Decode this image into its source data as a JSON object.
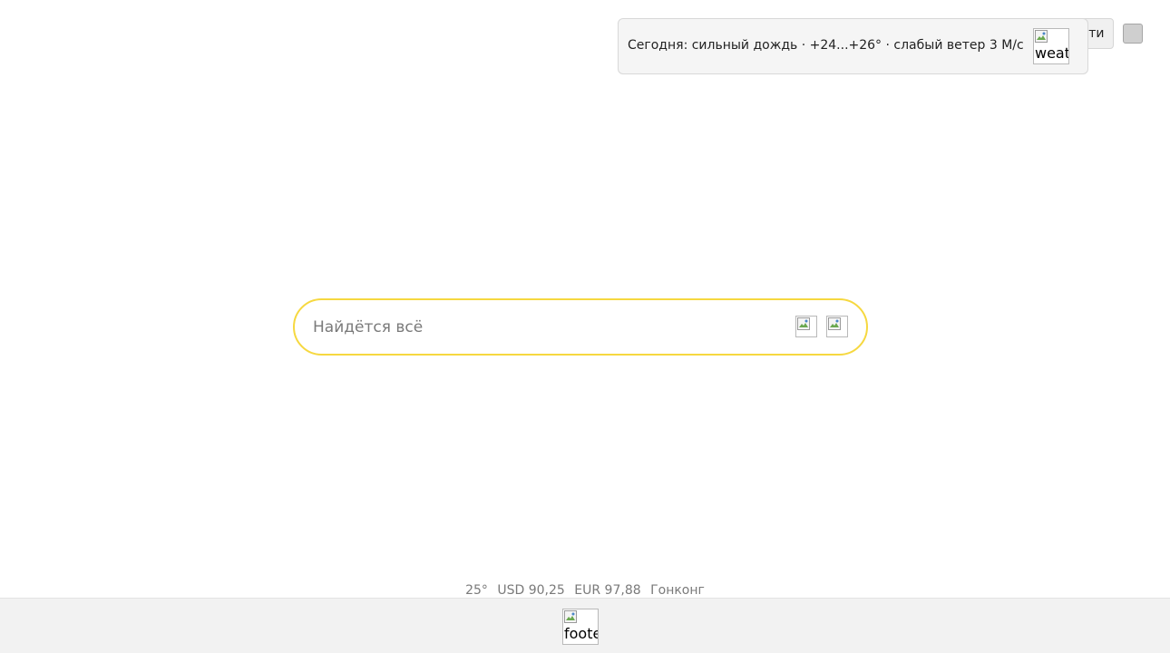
{
  "header": {
    "login_label": "Войти"
  },
  "weather_popup": {
    "text": "Сегодня: сильный дождь · +24...+26° · слабый ветер 3 М/с",
    "image_alt": "weat"
  },
  "search": {
    "placeholder": "Найдётся всё",
    "value": ""
  },
  "info_line": {
    "temperature": "25°",
    "usd": "USD 90,25",
    "eur": "EUR 97,88",
    "city": "Гонконг"
  },
  "footer": {
    "image_alt": "foote"
  },
  "colors": {
    "search_border": "#f6d840",
    "footer_bg": "#f2f2f2",
    "muted_text": "#7a7a7a"
  }
}
